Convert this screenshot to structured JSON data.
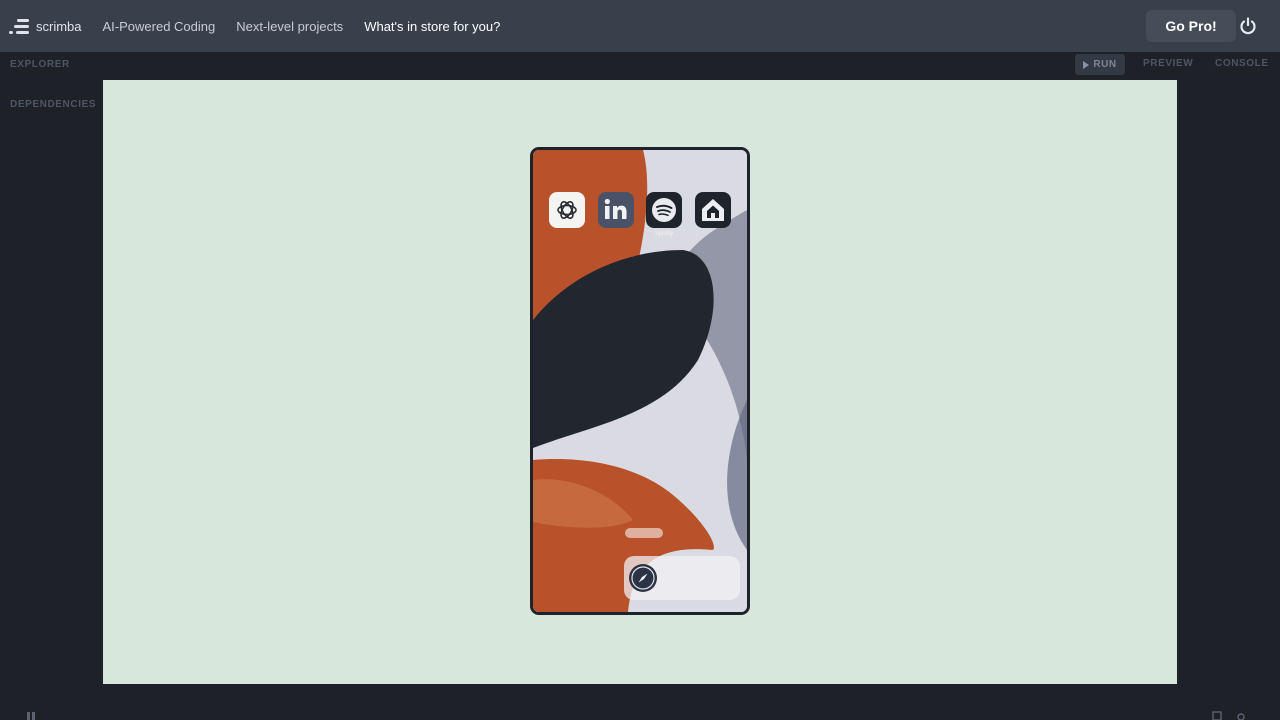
{
  "header": {
    "brand": "scrimba",
    "nav": [
      "AI-Powered Coding",
      "Next-level projects",
      "What's in store for you?"
    ],
    "cta": "Go Pro!",
    "power_icon": "power-icon"
  },
  "sidebar": {
    "explorer": "EXPLORER",
    "dependencies": "DEPENDENCIES"
  },
  "toolbar": {
    "run": "RUN",
    "preview": "PREVIEW",
    "console": "CONSOLE"
  },
  "phone": {
    "status_time": "",
    "apps": [
      {
        "name": "ChatGPT",
        "icon": "openai-icon",
        "label": ""
      },
      {
        "name": "LinkedIn",
        "icon": "linkedin-icon",
        "label": ""
      },
      {
        "name": "Spotify",
        "icon": "spotify-icon",
        "label": "Spotify"
      },
      {
        "name": "Home",
        "icon": "home-icon",
        "label": ""
      }
    ],
    "dock_icon": "safari-icon"
  },
  "colors": {
    "topbar": "#3a3f4c",
    "page": "#1e2128",
    "preview_bg": "#d7e7dc",
    "accent_orange": "#b9522a",
    "dark_blob": "#22262f"
  }
}
